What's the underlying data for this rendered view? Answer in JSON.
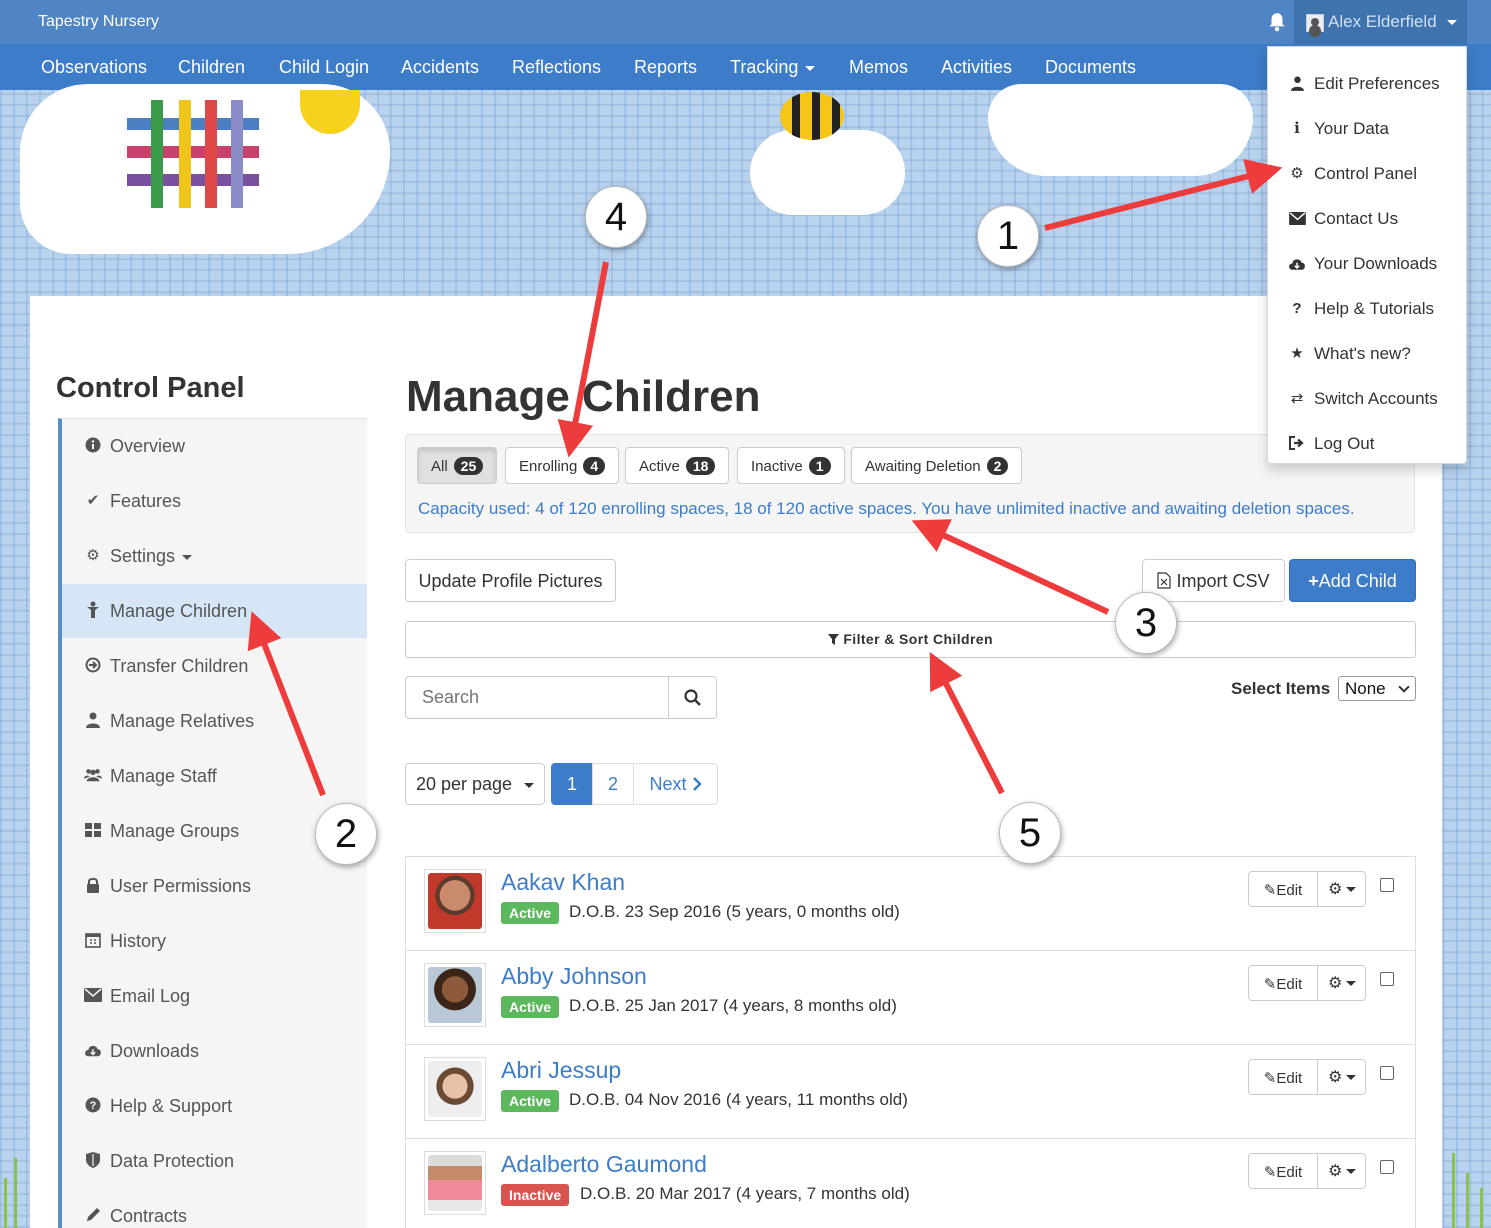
{
  "app": {
    "brand": "Tapestry Nursery"
  },
  "user": {
    "name": "Alex Elderfield"
  },
  "nav": [
    {
      "label": "Observations"
    },
    {
      "label": "Children"
    },
    {
      "label": "Child Login"
    },
    {
      "label": "Accidents"
    },
    {
      "label": "Reflections"
    },
    {
      "label": "Reports"
    },
    {
      "label": "Tracking"
    },
    {
      "label": "Memos"
    },
    {
      "label": "Activities"
    },
    {
      "label": "Documents"
    }
  ],
  "user_menu": [
    {
      "label": "Edit Preferences",
      "icon": "user-icon"
    },
    {
      "label": "Your Data",
      "icon": "info-icon"
    },
    {
      "label": "Control Panel",
      "icon": "gear-icon"
    },
    {
      "label": "Contact Us",
      "icon": "envelope-icon"
    },
    {
      "label": "Your Downloads",
      "icon": "cloud-download-icon"
    },
    {
      "label": "Help & Tutorials",
      "icon": "question-icon"
    },
    {
      "label": "What's new?",
      "icon": "star-icon"
    },
    {
      "label": "Switch Accounts",
      "icon": "switch-icon"
    },
    {
      "label": "Log Out",
      "icon": "logout-icon"
    }
  ],
  "sidebar": {
    "title": "Control Panel",
    "items": [
      {
        "label": "Overview",
        "icon": "info-circle-icon"
      },
      {
        "label": "Features",
        "icon": "check-icon"
      },
      {
        "label": "Settings",
        "icon": "gear-icon"
      },
      {
        "label": "Manage Children",
        "icon": "child-icon"
      },
      {
        "label": "Transfer Children",
        "icon": "transfer-icon"
      },
      {
        "label": "Manage Relatives",
        "icon": "user-icon"
      },
      {
        "label": "Manage Staff",
        "icon": "users-icon"
      },
      {
        "label": "Manage Groups",
        "icon": "grid-icon"
      },
      {
        "label": "User Permissions",
        "icon": "lock-icon"
      },
      {
        "label": "History",
        "icon": "calendar-icon"
      },
      {
        "label": "Email Log",
        "icon": "envelope-icon"
      },
      {
        "label": "Downloads",
        "icon": "cloud-download-icon"
      },
      {
        "label": "Help & Support",
        "icon": "question-circle-icon"
      },
      {
        "label": "Data Protection",
        "icon": "shield-icon"
      },
      {
        "label": "Contracts",
        "icon": "pencil-icon"
      }
    ]
  },
  "main": {
    "title": "Manage Children",
    "tabs": [
      {
        "label": "All",
        "count": "25"
      },
      {
        "label": "Enrolling",
        "count": "4"
      },
      {
        "label": "Active",
        "count": "18"
      },
      {
        "label": "Inactive",
        "count": "1"
      },
      {
        "label": "Awaiting Deletion",
        "count": "2"
      }
    ],
    "capacity": "Capacity used: 4 of 120 enrolling spaces, 18 of 120 active spaces. You have unlimited inactive and awaiting deletion spaces.",
    "update_pictures": "Update Profile Pictures",
    "import_csv": "Import CSV",
    "add_child": "Add Child",
    "filter_sort": "Filter & Sort Children",
    "search_placeholder": "Search",
    "select_items_label": "Select Items",
    "select_items_value": "None",
    "per_page": "20 per page",
    "pages": [
      "1",
      "2"
    ],
    "next": "Next",
    "edit_label": "Edit"
  },
  "children": [
    {
      "name": "Aakav Khan",
      "status": "Active",
      "dob": "D.O.B. 23 Sep 2016 (5 years, 0 months old)"
    },
    {
      "name": "Abby Johnson",
      "status": "Active",
      "dob": "D.O.B. 25 Jan 2017 (4 years, 8 months old)"
    },
    {
      "name": "Abri Jessup",
      "status": "Active",
      "dob": "D.O.B. 04 Nov 2016 (4 years, 11 months old)"
    },
    {
      "name": "Adalberto Gaumond",
      "status": "Inactive",
      "dob": "D.O.B. 20 Mar 2017 (4 years, 7 months old)"
    }
  ],
  "annotations": [
    "1",
    "2",
    "3",
    "4",
    "5"
  ],
  "colors": {
    "navbar": "#3d7cc9",
    "topbar": "#4f85c4",
    "active_status": "#5cb85c",
    "inactive_status": "#d9534f",
    "arrow": "#ee3b3b"
  }
}
